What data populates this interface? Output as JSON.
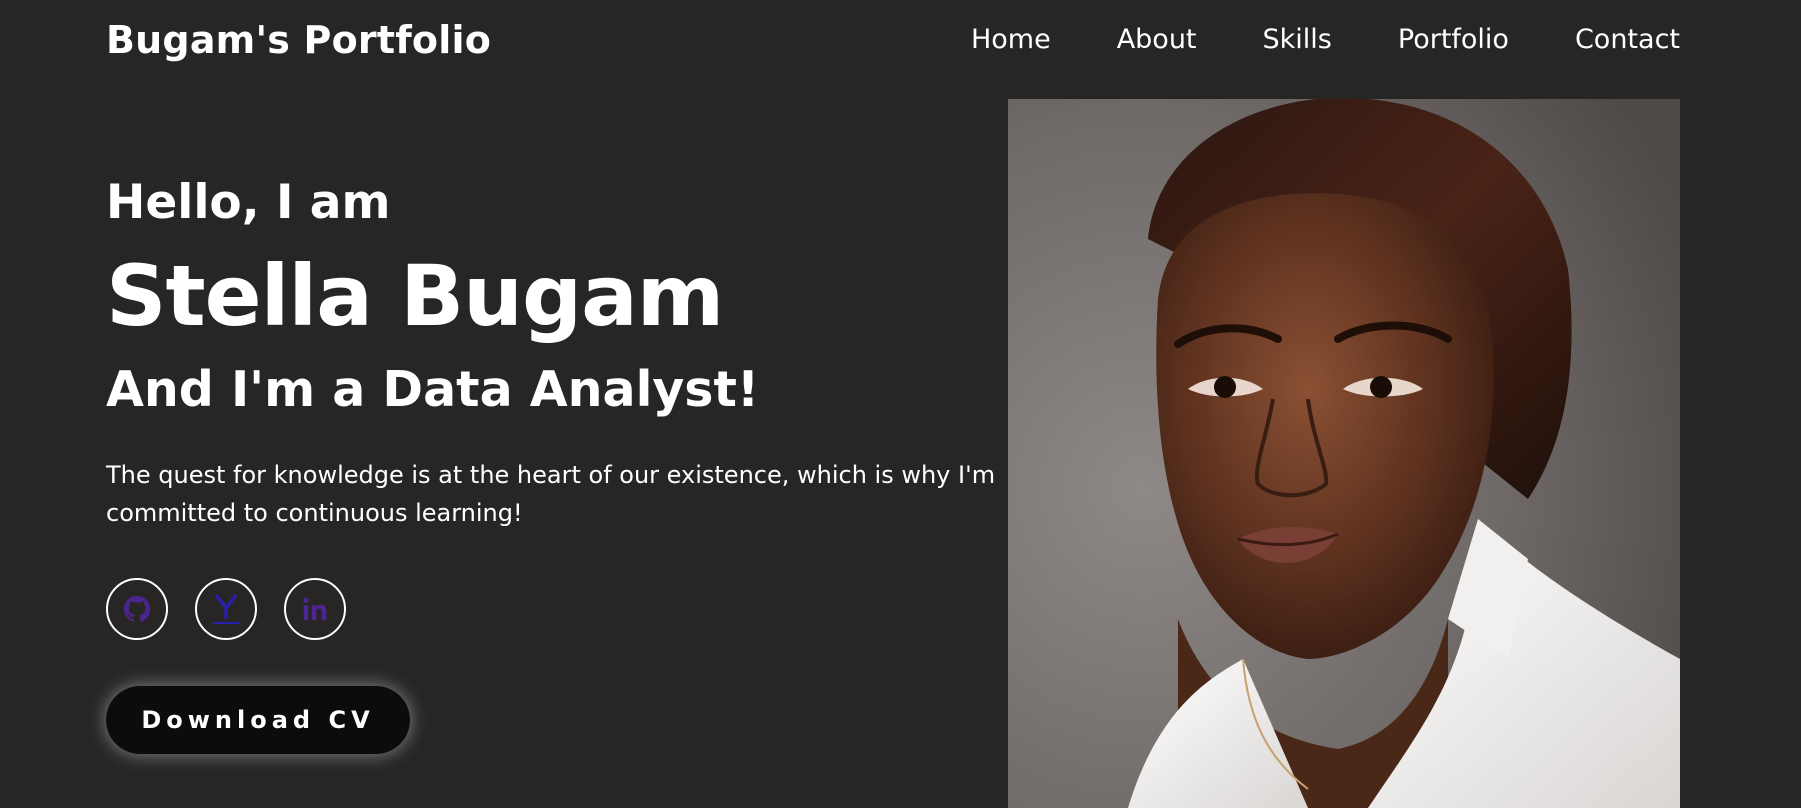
{
  "header": {
    "logo": "Bugam's Portfolio",
    "nav": [
      "Home",
      "About",
      "Skills",
      "Portfolio",
      "Contact"
    ]
  },
  "hero": {
    "greeting": "Hello, I am",
    "name": "Stella Bugam",
    "role": "And I'm a Data Analyst!",
    "tagline": "The quest for knowledge is at the heart of our existence, which is why I'm committed to continuous learning!"
  },
  "socials": [
    {
      "icon": "github-icon"
    },
    {
      "icon": "y-letter-icon"
    },
    {
      "icon": "linkedin-icon"
    }
  ],
  "cta": {
    "download_label": "Download CV"
  },
  "colors": {
    "background": "#282625",
    "text": "#ffffff",
    "button_bg": "#0d0c0c",
    "icon_purple": "#4b2590"
  }
}
